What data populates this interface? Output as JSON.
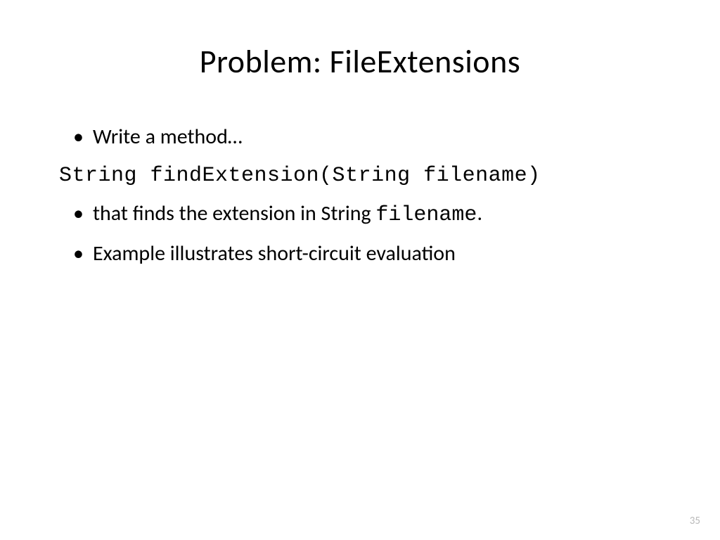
{
  "title": "Problem: FileExtensions",
  "bullets": {
    "b1": "Write a method…",
    "code": "String findExtension(String filename)",
    "b2_prefix": "that finds the extension in String ",
    "b2_code": "filename",
    "b2_suffix": ".",
    "b3": "Example illustrates short-circuit evaluation"
  },
  "page_number": "35"
}
